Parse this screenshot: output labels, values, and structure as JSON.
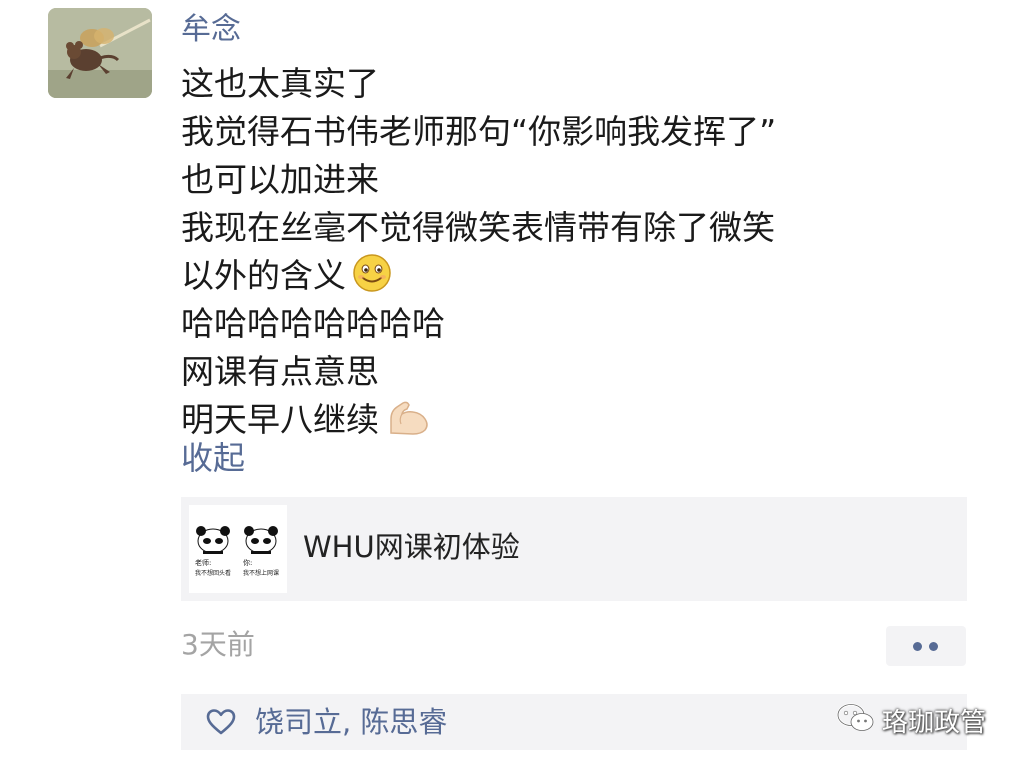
{
  "post": {
    "author": "牟念",
    "lines": [
      "这也太真实了",
      "我觉得石书伟老师那句“你影响我发挥了”",
      "也可以加进来",
      "我现在丝毫不觉得微笑表情带有除了微笑",
      "以外的含义",
      "哈哈哈哈哈哈哈哈",
      "网课有点意思",
      "明天早八继续"
    ],
    "collapse_label": "收起",
    "timestamp": "3天前"
  },
  "link_card": {
    "title": "WHU网课初体验",
    "thumb_left_caption_1": "老师:",
    "thumb_left_caption_2": "我不想回头看",
    "thumb_right_caption_1": "你:",
    "thumb_right_caption_2": "我不想上网课"
  },
  "likes": {
    "names": "饶司立, 陈思睿"
  },
  "watermark": {
    "text": "珞珈政管"
  },
  "colors": {
    "link_blue": "#576b95",
    "card_bg": "#f3f3f5",
    "text": "#1a1a1a",
    "muted": "#a4a4a4"
  },
  "icons": {
    "avatar": "cartoon-mouse-flying-avatar",
    "emoji_1": "smile-emoji",
    "emoji_2": "flexed-biceps-emoji",
    "more": "two-dots-more-icon",
    "like": "heart-outline-icon",
    "watermark": "wechat-logo-icon"
  }
}
